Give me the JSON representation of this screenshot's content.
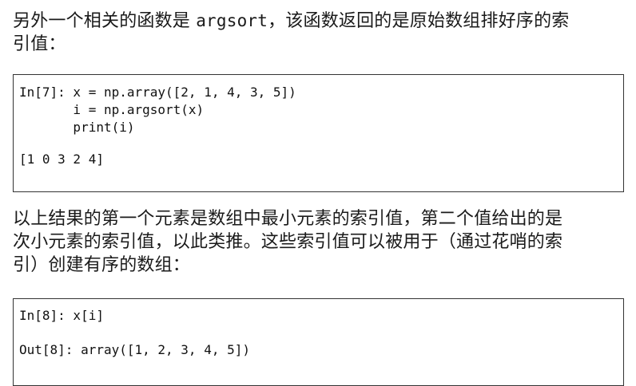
{
  "intro": {
    "line1_before": "另外一个相关的函数是 ",
    "line1_code": "argsort",
    "line1_after": "，该函数返回的是原始数组排好序的索",
    "line2": "引值："
  },
  "cell7": {
    "lines": [
      "In[7]: x = np.array([2, 1, 4, 3, 5])",
      "       i = np.argsort(x)",
      "       print(i)",
      "[1 0 3 2 4]"
    ]
  },
  "middle": {
    "line1": "以上结果的第一个元素是数组中最小元素的索引值，第二个值给出的是",
    "line2": "次小元素的索引值，以此类推。这些索引值可以被用于（通过花哨的索",
    "line3": "引）创建有序的数组："
  },
  "cell8": {
    "lines": [
      "In[8]: x[i]",
      "Out[8]: array([1, 2, 3, 4, 5])"
    ]
  }
}
